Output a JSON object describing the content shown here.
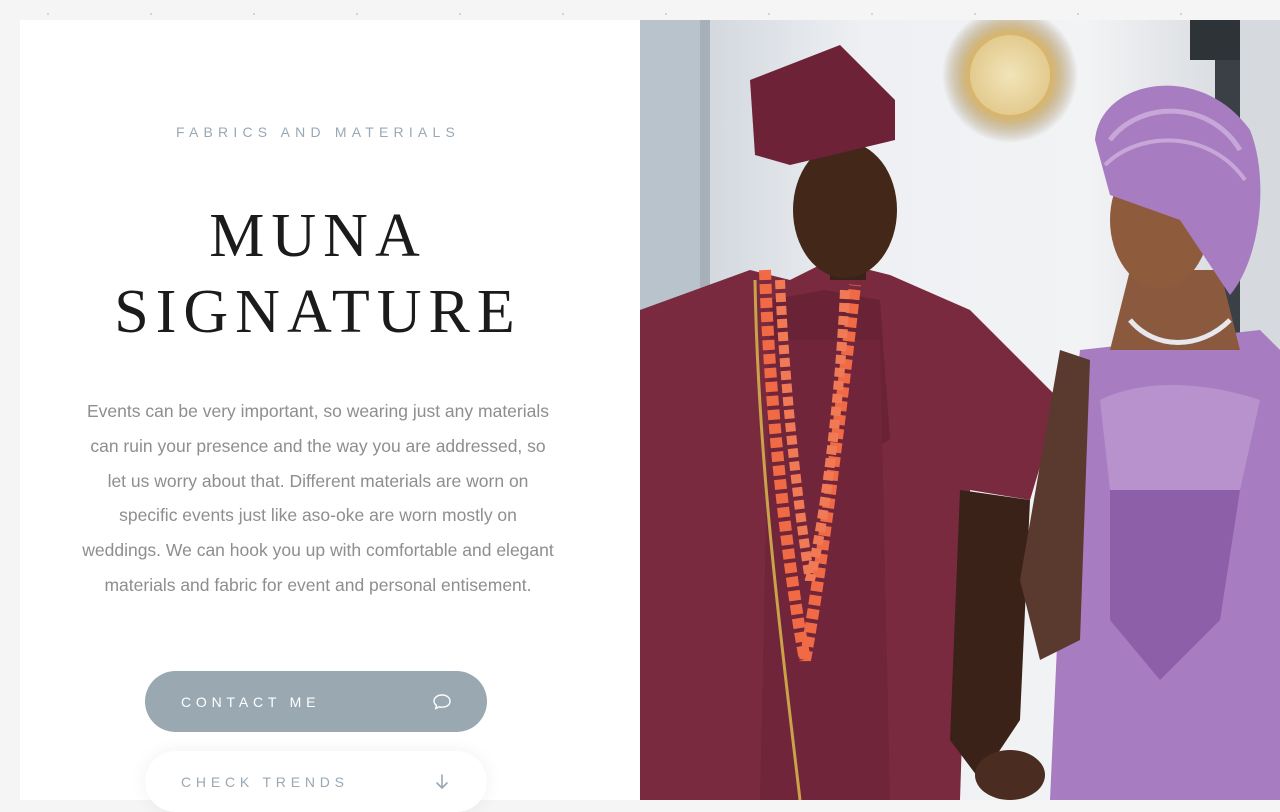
{
  "section": {
    "eyebrow": "FABRICS AND MATERIALS",
    "title_line1": "MUNA",
    "title_line2": "SIGNATURE",
    "description": "Events can be very important, so wearing just any materials can ruin your presence and the way you are addressed, so let us worry about that. Different materials are worn on specific events just like aso-oke are worn mostly on weddings. We can hook you up with comfortable and elegant materials and fabric for event and personal entisement."
  },
  "buttons": {
    "contact_label": "CONTACT ME",
    "contact_icon": "chat-bubble-icon",
    "trends_label": "CHECK TRENDS",
    "trends_icon": "arrow-down-icon"
  },
  "hero_image": {
    "subject": "couple in traditional Yoruba attire holding hands",
    "alt": "Couple in traditional attire"
  },
  "colors": {
    "accent": "#9aa8b2",
    "title": "#1b1b1b",
    "body_text": "#8e8e8e",
    "agbada": "#7a2a3e",
    "gele": "#a77cc0",
    "coral_beads": "#f06a45"
  }
}
